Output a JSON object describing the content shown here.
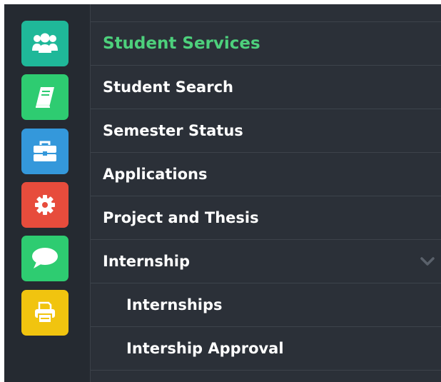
{
  "colors": {
    "rail_background": "#252a31",
    "menu_background": "#2b3038",
    "active_text": "#4dd07c",
    "text": "#ffffff"
  },
  "app_icons": [
    {
      "icon": "users-icon",
      "color": "#1fb899"
    },
    {
      "icon": "book-icon",
      "color": "#2ecc71"
    },
    {
      "icon": "briefcase-icon",
      "color": "#3498db"
    },
    {
      "icon": "gear-icon",
      "color": "#e74c3c"
    },
    {
      "icon": "chat-bubble-icon",
      "color": "#2ecc71"
    },
    {
      "icon": "printer-icon",
      "color": "#f1c40f"
    }
  ],
  "menu": {
    "title": "Student Services",
    "items": [
      {
        "label": "Student Search"
      },
      {
        "label": "Semester Status"
      },
      {
        "label": "Applications"
      },
      {
        "label": "Project and Thesis"
      },
      {
        "label": "Internship",
        "expanded": true,
        "icon": "chevron-down-icon"
      }
    ],
    "subitems": [
      {
        "label": "Internships"
      },
      {
        "label": "Intership Approval"
      }
    ]
  }
}
